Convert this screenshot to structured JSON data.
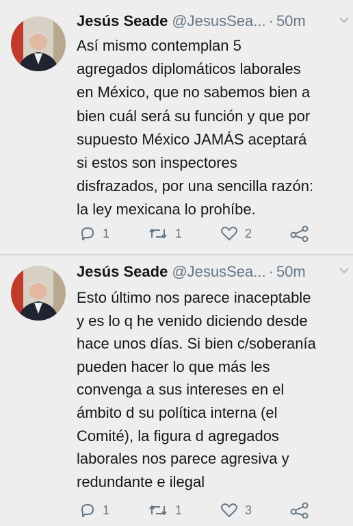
{
  "tweets": [
    {
      "author_name": "Jesús Seade",
      "handle": "@JesusSea...",
      "separator": "·",
      "time": "50m",
      "text_lines": [
        "Así mismo contemplan 5",
        "agregados diplomáticos laborales",
        "en México, que no sabemos bien a",
        "bien cuál será su función y que por",
        "supuesto México JAMÁS aceptará",
        "si estos son inspectores",
        "disfrazados, por una sencilla razón:",
        "la ley mexicana lo prohíbe."
      ],
      "replies": "1",
      "retweets": "1",
      "likes": "2"
    },
    {
      "author_name": "Jesús Seade",
      "handle": "@JesusSea...",
      "separator": "·",
      "time": "50m",
      "text_lines": [
        "Esto último nos parece inaceptable",
        "y es lo q he venido diciendo desde",
        "hace unos días. Si bien c/soberanía",
        "pueden hacer lo que más les",
        "convenga a sus intereses en el",
        "ámbito d su política interna (el",
        "Comité), la figura d agregados",
        "laborales nos parece agresiva y",
        "redundante e ilegal"
      ],
      "replies": "1",
      "retweets": "1",
      "likes": "3"
    }
  ],
  "icons": {
    "reply": "reply-icon",
    "retweet": "retweet-icon",
    "like": "heart-icon",
    "share": "share-icon",
    "menu": "chevron-down-icon"
  },
  "colors": {
    "background": "#eeeeee",
    "text": "#14171a",
    "secondary": "#657786"
  }
}
